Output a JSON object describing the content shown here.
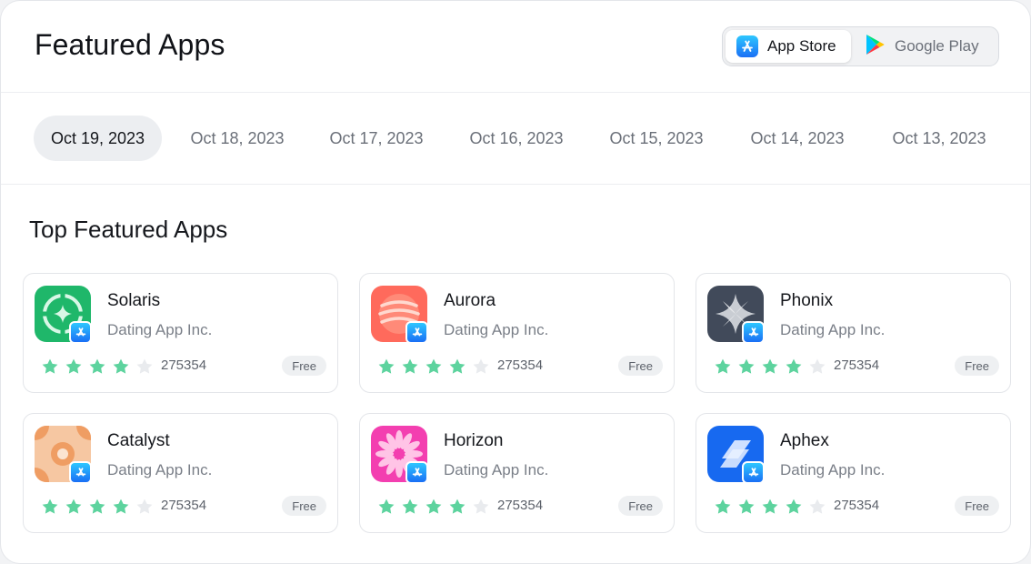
{
  "page": {
    "title": "Featured Apps"
  },
  "stores": [
    {
      "label": "App Store",
      "icon": "app-store-icon",
      "active": true
    },
    {
      "label": "Google Play",
      "icon": "google-play-icon",
      "active": false
    }
  ],
  "dates": [
    "Oct 19, 2023",
    "Oct 18, 2023",
    "Oct 17, 2023",
    "Oct 16, 2023",
    "Oct 15, 2023",
    "Oct 14, 2023",
    "Oct 13, 2023"
  ],
  "selected_date": "Oct 19, 2023",
  "section": {
    "title": "Top Featured Apps"
  },
  "colors": {
    "star_filled": "#5dd39e",
    "star_empty": "#e9ebee",
    "app_store_blue": "#1a8cff"
  },
  "apps": [
    {
      "name": "Solaris",
      "developer": "Dating App Inc.",
      "stars": 4,
      "ratings": "275354",
      "price": "Free",
      "icon": "solaris-app-icon"
    },
    {
      "name": "Aurora",
      "developer": "Dating App Inc.",
      "stars": 4,
      "ratings": "275354",
      "price": "Free",
      "icon": "aurora-app-icon"
    },
    {
      "name": "Phonix",
      "developer": "Dating App Inc.",
      "stars": 4,
      "ratings": "275354",
      "price": "Free",
      "icon": "phonix-app-icon"
    },
    {
      "name": "Catalyst",
      "developer": "Dating App Inc.",
      "stars": 4,
      "ratings": "275354",
      "price": "Free",
      "icon": "catalyst-app-icon"
    },
    {
      "name": "Horizon",
      "developer": "Dating App Inc.",
      "stars": 4,
      "ratings": "275354",
      "price": "Free",
      "icon": "horizon-app-icon"
    },
    {
      "name": "Aphex",
      "developer": "Dating App Inc.",
      "stars": 4,
      "ratings": "275354",
      "price": "Free",
      "icon": "aphex-app-icon"
    }
  ]
}
